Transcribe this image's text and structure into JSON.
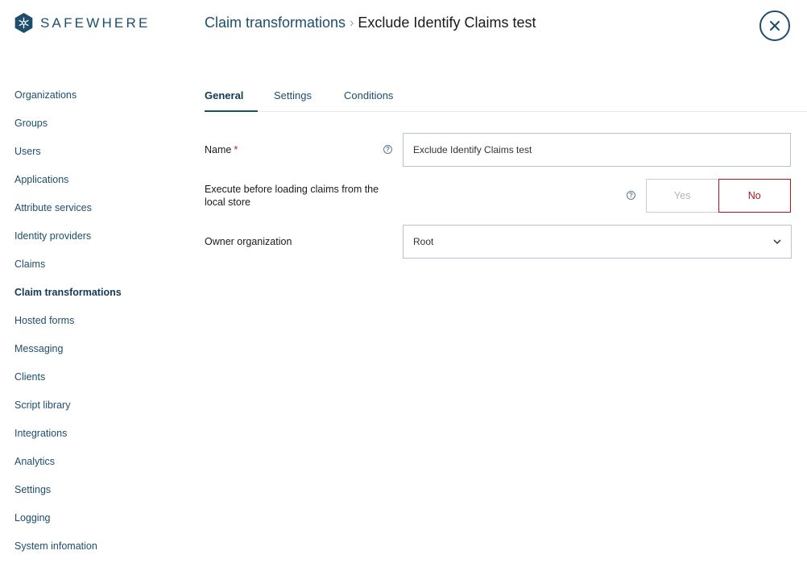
{
  "brand": {
    "name": "SAFEWHERE",
    "icon": "safewhere-logo-icon",
    "color": "#1d4e6b"
  },
  "header": {
    "breadcrumb_parent": "Claim transformations",
    "breadcrumb_separator": "›",
    "breadcrumb_current": "Exclude Identify Claims test",
    "close_icon": "close-icon"
  },
  "sidebar": {
    "items": [
      {
        "label": "Organizations"
      },
      {
        "label": "Groups"
      },
      {
        "label": "Users"
      },
      {
        "label": "Applications"
      },
      {
        "label": "Attribute services"
      },
      {
        "label": "Identity providers"
      },
      {
        "label": "Claims"
      },
      {
        "label": "Claim transformations",
        "active": true
      },
      {
        "label": "Hosted forms"
      },
      {
        "label": "Messaging"
      },
      {
        "label": "Clients"
      },
      {
        "label": "Script library"
      },
      {
        "label": "Integrations"
      },
      {
        "label": "Analytics"
      },
      {
        "label": "Settings"
      },
      {
        "label": "Logging"
      },
      {
        "label": "System infomation"
      }
    ]
  },
  "tabs": [
    {
      "label": "General",
      "active": true
    },
    {
      "label": "Settings"
    },
    {
      "label": "Conditions"
    }
  ],
  "form": {
    "name": {
      "label": "Name",
      "required_mark": "*",
      "value": "Exclude Identify Claims test",
      "help_icon": "help-icon"
    },
    "execute_before": {
      "label": "Execute before loading claims from the local store",
      "help_icon": "help-icon",
      "options": [
        "Yes",
        "No"
      ],
      "selected": "No"
    },
    "owner_org": {
      "label": "Owner organization",
      "value": "Root",
      "chevron_icon": "chevron-down-icon"
    }
  },
  "colors": {
    "accent": "#1d4e6b",
    "selected_no": "#b3121f",
    "required": "#c0152a"
  }
}
